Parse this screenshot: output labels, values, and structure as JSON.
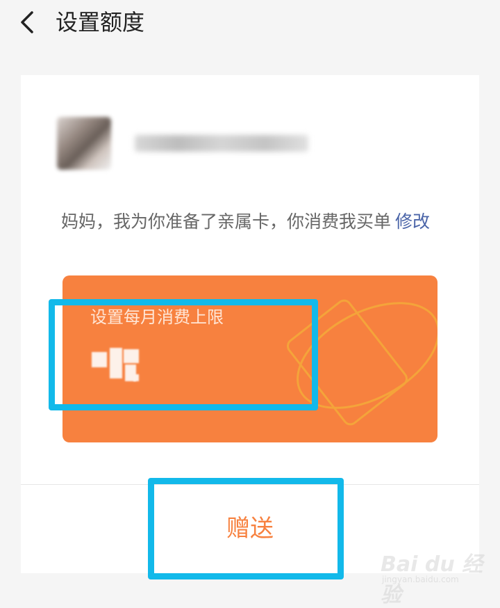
{
  "header": {
    "title": "设置额度"
  },
  "message": {
    "text": "妈妈，我为你准备了亲属卡，你消费我买单",
    "modify": "修改"
  },
  "card": {
    "label": "设置每月消费上限",
    "amount": ""
  },
  "action": {
    "gift_label": "赠送"
  },
  "watermark": {
    "main": "Bai du 经验",
    "sub": "jingyan.baidu.com"
  },
  "colors": {
    "accent": "#f7813f",
    "highlight": "#12b9ea",
    "link": "#4a64a8"
  }
}
